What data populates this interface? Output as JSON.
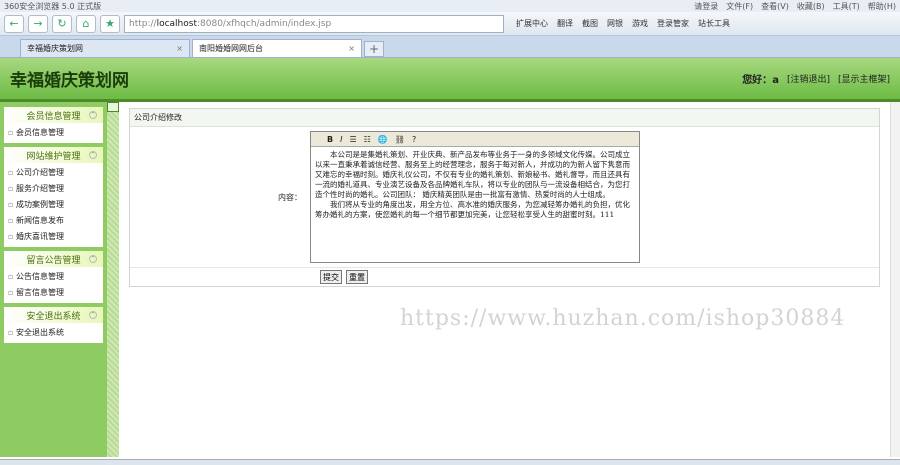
{
  "browser": {
    "title": "360安全浏览器 5.0 正式版",
    "menu": [
      "请登录",
      "文件(F)",
      "查看(V)",
      "收藏(B)",
      "工具(T)",
      "帮助(H)"
    ],
    "url_prefix": "http://",
    "url_host": "localhost",
    "url_rest": ":8080/xfhqch/admin/index.jsp",
    "tools": [
      "扩展中心",
      "翻译",
      "截图",
      "网银",
      "游戏",
      "登录管家",
      "站长工具"
    ],
    "tabs": [
      {
        "label": "幸福婚庆策划网"
      },
      {
        "label": "南阳婚婚网网后台"
      }
    ]
  },
  "header": {
    "logo": "幸福婚庆策划网",
    "greeting": "您好：",
    "user": "a",
    "logout": "[注销退出]",
    "show_frame": "[显示主框架]"
  },
  "sidebar": [
    {
      "title": "会员信息管理",
      "items": [
        "会员信息管理"
      ]
    },
    {
      "title": "网站维护管理",
      "items": [
        "公司介绍管理",
        "服务介绍管理",
        "成功案例管理",
        "新闻信息发布",
        "婚庆喜讯管理"
      ]
    },
    {
      "title": "留言公告管理",
      "items": [
        "公告信息管理",
        "留言信息管理"
      ]
    },
    {
      "title": "安全退出系统",
      "items": [
        "安全退出系统"
      ]
    }
  ],
  "panel": {
    "title": "公司介绍修改",
    "content_label": "内容：",
    "para1": "本公司是是集婚礼策划、开业庆典、新产品发布等业务于一身的多领域文化传媒。公司成立以来一直秉承着诚信经营、服务至上的经营理念，服务于每对新人，并成功的为新人留下隽意而又难忘的幸福时刻。婚庆礼仪公司，不仅有专业的婚礼策划、新娘秘书、婚礼督导，而且还具有一流的婚礼道具、专业演艺设备及各品牌婚礼车队，将以专业的团队与一流设备相结合，为您打造个性时尚的婚礼。公司团队： 婚庆精英团队是由一批富有激情、热爱时尚的人士组成。",
    "para2": "我们将从专业的角度出发，用全方位、高水准的婚庆服务，为您减轻筹办婚礼的负担，优化筹办婚礼的方案，使您婚礼的每一个细节都更加完美，让您轻松享受人生的甜蜜时刻。111",
    "submit": "提交",
    "reset": "重置"
  },
  "watermark": "https://www.huzhan.com/ishop30884"
}
